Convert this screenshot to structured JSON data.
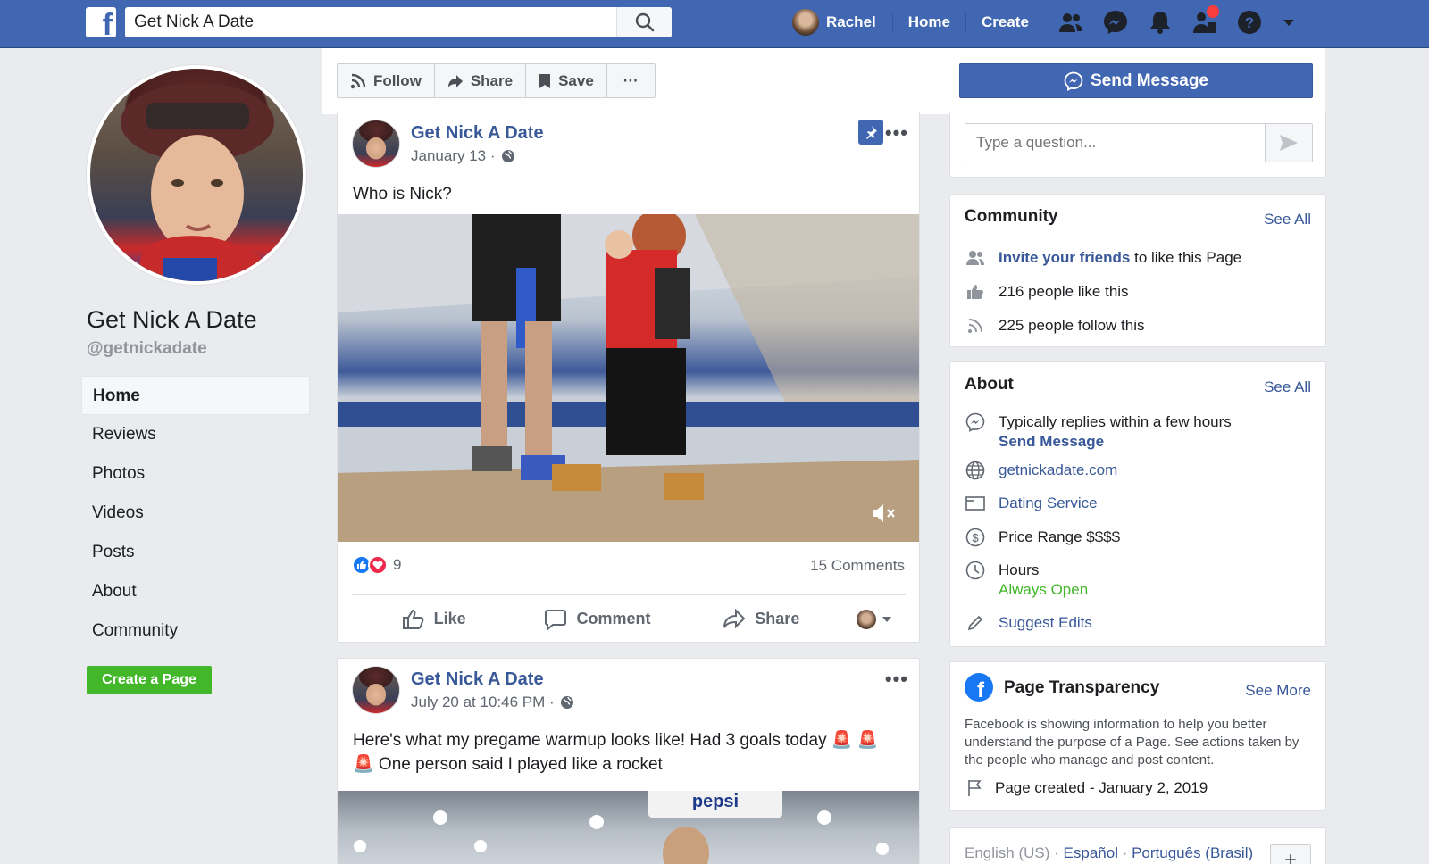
{
  "topbar": {
    "logo": "f",
    "search_value": "Get Nick A Date",
    "user_name": "Rachel",
    "home_label": "Home",
    "create_label": "Create",
    "icons": [
      "friends-icon",
      "messenger-icon",
      "notifications-icon",
      "page-manager-icon",
      "help-icon",
      "dropdown-icon"
    ]
  },
  "profile": {
    "name": "Get Nick A Date",
    "handle": "@getnickadate"
  },
  "sidebar": {
    "items": [
      {
        "label": "Home"
      },
      {
        "label": "Reviews"
      },
      {
        "label": "Photos"
      },
      {
        "label": "Videos"
      },
      {
        "label": "Posts"
      },
      {
        "label": "About"
      },
      {
        "label": "Community"
      }
    ],
    "create_page_label": "Create a Page"
  },
  "actionbar": {
    "follow": "Follow",
    "share": "Share",
    "save": "Save",
    "more": "···",
    "send_message": "Send Message"
  },
  "posts": [
    {
      "author": "Get Nick A Date",
      "date": "January 13 ·",
      "text": "Who is Nick?",
      "reaction_count": "9",
      "comments": "15 Comments",
      "actions": {
        "like": "Like",
        "comment": "Comment",
        "share": "Share"
      }
    },
    {
      "author": "Get Nick A Date",
      "date": "July 20 at 10:46 PM ·",
      "text_line1": "Here's what my pregame warmup looks like! Had 3 goals today 🚨 🚨",
      "text_line2": "🚨 One person said I played like a rocket",
      "video_sign": "pepsi"
    }
  ],
  "question": {
    "placeholder": "Type a question..."
  },
  "community": {
    "title": "Community",
    "see_all": "See All",
    "invite_link": "Invite your friends",
    "invite_rest": " to like this Page",
    "likes": "216 people like this",
    "follows": "225 people follow this"
  },
  "about": {
    "title": "About",
    "see_all": "See All",
    "replies": "Typically replies within a few hours",
    "send_message": "Send Message",
    "website": "getnickadate.com",
    "category": "Dating Service",
    "price": "Price Range $$$$",
    "hours_label": "Hours",
    "hours_value": "Always Open",
    "suggest": "Suggest Edits"
  },
  "transparency": {
    "title": "Page Transparency",
    "see_more": "See More",
    "description": "Facebook is showing information to help you better understand the purpose of a Page. See actions taken by the people who manage and post content.",
    "created": "Page created - January 2, 2019"
  },
  "languages": {
    "current": "English (US)",
    "sep": " · ",
    "lang2": "Español",
    "lang3": "Português (Brasil)",
    "add": "+"
  },
  "colors": {
    "brand_blue": "#4267b2",
    "link_blue": "#385898",
    "green": "#42b72a",
    "notif_red": "#fa3e3e"
  }
}
